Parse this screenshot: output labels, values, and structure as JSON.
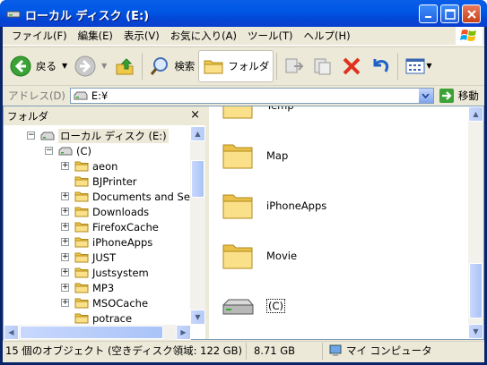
{
  "window": {
    "title": "ローカル ディスク (E:)"
  },
  "menu": [
    "ファイル(F)",
    "編集(E)",
    "表示(V)",
    "お気に入り(A)",
    "ツール(T)",
    "ヘルプ(H)"
  ],
  "toolbar": {
    "back": "戻る",
    "search": "検索",
    "folders": "フォルダ"
  },
  "address": {
    "label": "アドレス(D)",
    "value": "E:¥",
    "go": "移動"
  },
  "tree": {
    "header": "フォルダ",
    "close": "×",
    "root": "ローカル ディスク (E:)",
    "drive": "(C)",
    "items": [
      "aeon",
      "BJPrinter",
      "Documents and Setti",
      "Downloads",
      "FirefoxCache",
      "iPhoneApps",
      "JUST",
      "Justsystem",
      "MP3",
      "MSOCache",
      "potrace"
    ]
  },
  "content": {
    "items": [
      "Temp",
      "Map",
      "iPhoneApps",
      "Movie",
      "(C)"
    ]
  },
  "status": {
    "objects": "15 個のオブジェクト (空きディスク領域: 122 GB)",
    "size": "8.71 GB",
    "location": "マイ コンピュータ"
  },
  "colors": {
    "titlebar": "#0058e6",
    "frame": "#ece9d8",
    "folder": "#f7d561"
  }
}
